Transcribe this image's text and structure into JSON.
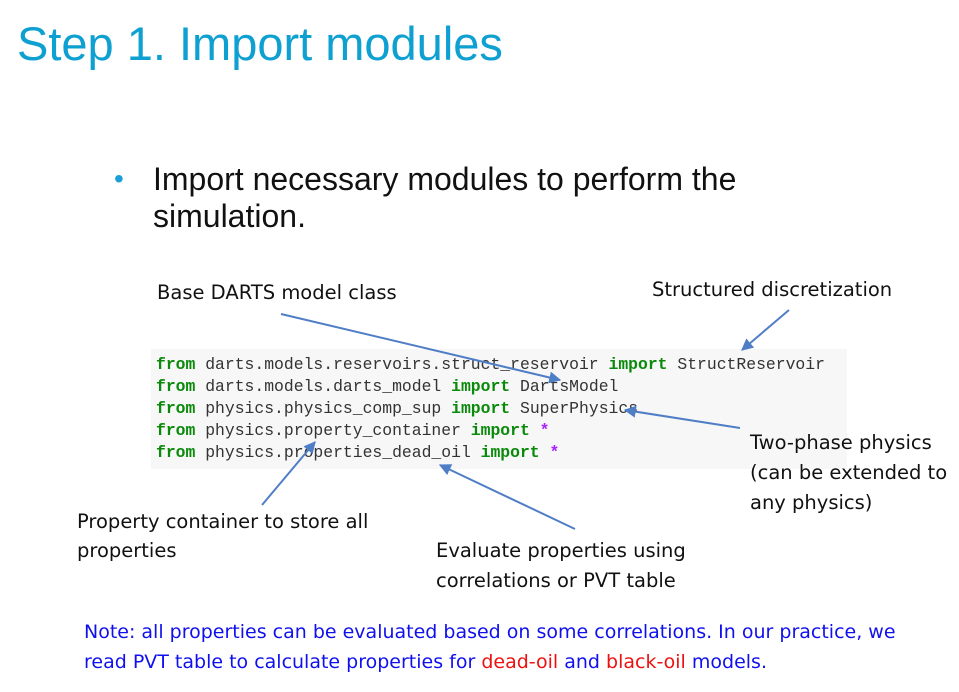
{
  "slide": {
    "title": "Step 1. Import modules",
    "bullet_marker": "•",
    "bullet_text": "Import necessary modules to perform the simulation."
  },
  "annotations": {
    "base_model": "Base DARTS model class",
    "structured": "Structured  discretization",
    "two_phase_line1": "Two-phase physics",
    "two_phase_line2": "(can be extended to",
    "two_phase_line3": "any physics)",
    "property_container_line1": "Property container to store all",
    "property_container_line2": "properties",
    "evaluate_line1": "Evaluate properties using",
    "evaluate_line2": "correlations or PVT table"
  },
  "code": [
    {
      "from": "from",
      "module": "darts.models.reservoirs.struct_reservoir",
      "import": "import",
      "name": "StructReservoir"
    },
    {
      "from": "from",
      "module": "darts.models.darts_model",
      "import": "import",
      "name": "DartsModel"
    },
    {
      "from": "from",
      "module": "physics.physics_comp_sup",
      "import": "import",
      "name": "SuperPhysics"
    },
    {
      "from": "from",
      "module": "physics.property_container",
      "import": "import",
      "name": "*"
    },
    {
      "from": "from",
      "module": "physics.properties_dead_oil",
      "import": "import",
      "name": "*"
    }
  ],
  "note": {
    "part1": "Note: all properties can be evaluated based on some correlations. In our practice, we read PVT table to calculate properties for ",
    "dead_oil": "dead-oil",
    "and": " and ",
    "black_oil": "black-oil",
    "part2": " models."
  },
  "colors": {
    "title": "#0fa0d2",
    "arrow": "#4f7ec6",
    "keyword": "#0a8a0a",
    "note_blue": "#1010ee",
    "note_red": "#ee1111"
  }
}
